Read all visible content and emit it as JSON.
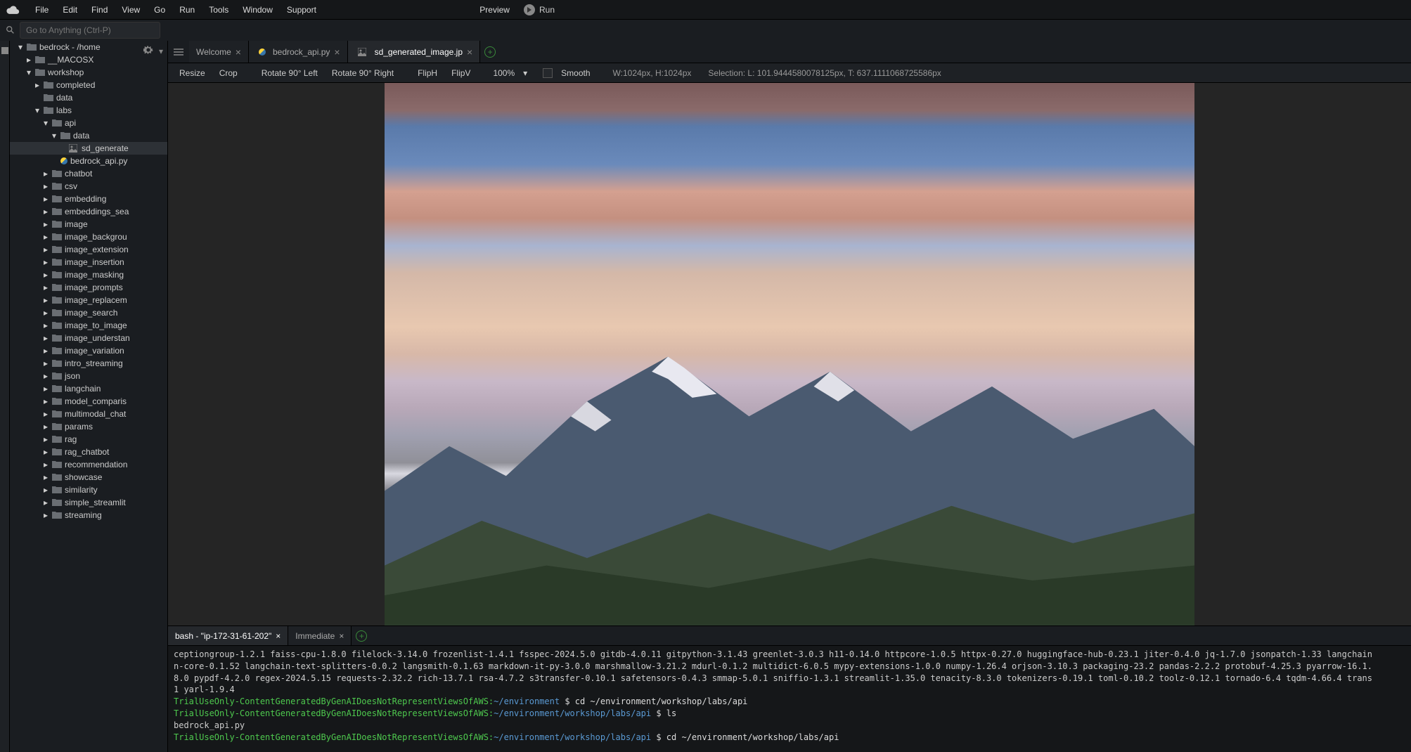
{
  "menubar": {
    "items": [
      "File",
      "Edit",
      "Find",
      "View",
      "Go",
      "Run",
      "Tools",
      "Window",
      "Support"
    ],
    "preview": "Preview",
    "run": "Run"
  },
  "goto_placeholder": "Go to Anything (Ctrl-P)",
  "filetree": {
    "root_label": "bedrock",
    "root_suffix": " - /home",
    "nodes": [
      {
        "depth": 0,
        "chev": "down",
        "type": "folder",
        "label": "bedrock - /home"
      },
      {
        "depth": 1,
        "chev": "right",
        "type": "folder",
        "label": "__MACOSX"
      },
      {
        "depth": 1,
        "chev": "down",
        "type": "folder",
        "label": "workshop"
      },
      {
        "depth": 2,
        "chev": "right",
        "type": "folder",
        "label": "completed"
      },
      {
        "depth": 2,
        "chev": "none",
        "type": "folder",
        "label": "data"
      },
      {
        "depth": 2,
        "chev": "down",
        "type": "folder",
        "label": "labs"
      },
      {
        "depth": 3,
        "chev": "down",
        "type": "folder",
        "label": "api"
      },
      {
        "depth": 4,
        "chev": "down",
        "type": "folder",
        "label": "data"
      },
      {
        "depth": 5,
        "chev": "none",
        "type": "image",
        "label": "sd_generate",
        "selected": true
      },
      {
        "depth": 4,
        "chev": "none",
        "type": "python",
        "label": "bedrock_api.py"
      },
      {
        "depth": 3,
        "chev": "right",
        "type": "folder",
        "label": "chatbot"
      },
      {
        "depth": 3,
        "chev": "right",
        "type": "folder",
        "label": "csv"
      },
      {
        "depth": 3,
        "chev": "right",
        "type": "folder",
        "label": "embedding"
      },
      {
        "depth": 3,
        "chev": "right",
        "type": "folder",
        "label": "embeddings_sea"
      },
      {
        "depth": 3,
        "chev": "right",
        "type": "folder",
        "label": "image"
      },
      {
        "depth": 3,
        "chev": "right",
        "type": "folder",
        "label": "image_backgrou"
      },
      {
        "depth": 3,
        "chev": "right",
        "type": "folder",
        "label": "image_extension"
      },
      {
        "depth": 3,
        "chev": "right",
        "type": "folder",
        "label": "image_insertion"
      },
      {
        "depth": 3,
        "chev": "right",
        "type": "folder",
        "label": "image_masking"
      },
      {
        "depth": 3,
        "chev": "right",
        "type": "folder",
        "label": "image_prompts"
      },
      {
        "depth": 3,
        "chev": "right",
        "type": "folder",
        "label": "image_replacem"
      },
      {
        "depth": 3,
        "chev": "right",
        "type": "folder",
        "label": "image_search"
      },
      {
        "depth": 3,
        "chev": "right",
        "type": "folder",
        "label": "image_to_image"
      },
      {
        "depth": 3,
        "chev": "right",
        "type": "folder",
        "label": "image_understan"
      },
      {
        "depth": 3,
        "chev": "right",
        "type": "folder",
        "label": "image_variation"
      },
      {
        "depth": 3,
        "chev": "right",
        "type": "folder",
        "label": "intro_streaming"
      },
      {
        "depth": 3,
        "chev": "right",
        "type": "folder",
        "label": "json"
      },
      {
        "depth": 3,
        "chev": "right",
        "type": "folder",
        "label": "langchain"
      },
      {
        "depth": 3,
        "chev": "right",
        "type": "folder",
        "label": "model_comparis"
      },
      {
        "depth": 3,
        "chev": "right",
        "type": "folder",
        "label": "multimodal_chat"
      },
      {
        "depth": 3,
        "chev": "right",
        "type": "folder",
        "label": "params"
      },
      {
        "depth": 3,
        "chev": "right",
        "type": "folder",
        "label": "rag"
      },
      {
        "depth": 3,
        "chev": "right",
        "type": "folder",
        "label": "rag_chatbot"
      },
      {
        "depth": 3,
        "chev": "right",
        "type": "folder",
        "label": "recommendation"
      },
      {
        "depth": 3,
        "chev": "right",
        "type": "folder",
        "label": "showcase"
      },
      {
        "depth": 3,
        "chev": "right",
        "type": "folder",
        "label": "similarity"
      },
      {
        "depth": 3,
        "chev": "right",
        "type": "folder",
        "label": "simple_streamlit"
      },
      {
        "depth": 3,
        "chev": "right",
        "type": "folder",
        "label": "streaming"
      }
    ]
  },
  "tabs": [
    {
      "label": "Welcome",
      "icon": "none",
      "active": false
    },
    {
      "label": "bedrock_api.py",
      "icon": "python",
      "active": false
    },
    {
      "label": "sd_generated_image.jp",
      "icon": "image",
      "active": true
    }
  ],
  "toolbar": {
    "resize": "Resize",
    "crop": "Crop",
    "rot_l": "Rotate 90° Left",
    "rot_r": "Rotate 90° Right",
    "fliph": "FlipH",
    "flipv": "FlipV",
    "zoom": "100%",
    "smooth": "Smooth",
    "dims": "W:1024px, H:1024px",
    "selection": "Selection:   L: 101.9444580078125px, T: 637.1111068725586px"
  },
  "terminal": {
    "tabs": [
      {
        "label": "bash - \"ip-172-31-61-202\"",
        "active": true
      },
      {
        "label": "Immediate",
        "active": false
      }
    ],
    "lines": [
      {
        "type": "plain",
        "text": "ceptiongroup-1.2.1 faiss-cpu-1.8.0 filelock-3.14.0 frozenlist-1.4.1 fsspec-2024.5.0 gitdb-4.0.11 gitpython-3.1.43 greenlet-3.0.3 h11-0.14.0 httpcore-1.0.5 httpx-0.27.0 huggingface-hub-0.23.1 jiter-0.4.0 jq-1.7.0 jsonpatch-1.33 langchain"
      },
      {
        "type": "plain",
        "text": "n-core-0.1.52 langchain-text-splitters-0.0.2 langsmith-0.1.63 markdown-it-py-3.0.0 marshmallow-3.21.2 mdurl-0.1.2 multidict-6.0.5 mypy-extensions-1.0.0 numpy-1.26.4 orjson-3.10.3 packaging-23.2 pandas-2.2.2 protobuf-4.25.3 pyarrow-16.1."
      },
      {
        "type": "plain",
        "text": "8.0 pypdf-4.2.0 regex-2024.5.15 requests-2.32.2 rich-13.7.1 rsa-4.7.2 s3transfer-0.10.1 safetensors-0.4.3 smmap-5.0.1 sniffio-1.3.1 streamlit-1.35.0 tenacity-8.3.0 tokenizers-0.19.1 toml-0.10.2 toolz-0.12.1 tornado-6.4 tqdm-4.66.4 trans"
      },
      {
        "type": "plain",
        "text": "1 yarl-1.9.4"
      },
      {
        "type": "prompt",
        "user": "TrialUseOnly-ContentGeneratedByGenAIDoesNotRepresentViewsOfAWS:",
        "path": "~/environment",
        "cmd": "$ cd ~/environment/workshop/labs/api"
      },
      {
        "type": "prompt",
        "user": "TrialUseOnly-ContentGeneratedByGenAIDoesNotRepresentViewsOfAWS:",
        "path": "~/environment/workshop/labs/api",
        "cmd": "$ ls"
      },
      {
        "type": "plain",
        "text": "bedrock_api.py"
      },
      {
        "type": "prompt",
        "user": "TrialUseOnly-ContentGeneratedByGenAIDoesNotRepresentViewsOfAWS:",
        "path": "~/environment/workshop/labs/api",
        "cmd": "$ cd ~/environment/workshop/labs/api"
      }
    ]
  }
}
